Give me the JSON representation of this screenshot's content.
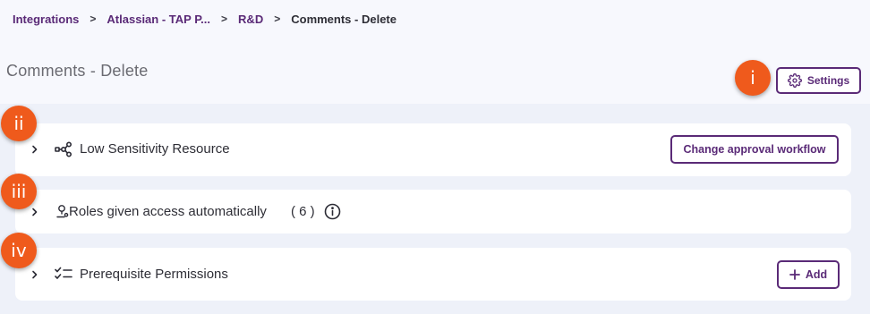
{
  "breadcrumb": {
    "items": [
      "Integrations",
      "Atlassian - TAP P...",
      "R&D"
    ],
    "current": "Comments - Delete",
    "separator": ">"
  },
  "page": {
    "title": "Comments - Delete"
  },
  "header": {
    "settings_label": "Settings"
  },
  "annotations": {
    "badge_1": "i",
    "badge_2": "ii",
    "badge_3": "iii",
    "badge_4": "iv"
  },
  "sections": {
    "sensitivity": {
      "label": "Low Sensitivity Resource",
      "action_label": "Change approval workflow",
      "icon": "workflow-icon"
    },
    "roles": {
      "label": "Roles given access automatically",
      "count": "( 6 )",
      "icon": "user-key-icon"
    },
    "prerequisites": {
      "label": "Prerequisite Permissions",
      "action_label": "Add",
      "icon": "checklist-icon"
    }
  },
  "colors": {
    "accent": "#5a2a77",
    "badge": "#ef5a1c",
    "background": "#eef1f9",
    "card": "#ffffff"
  }
}
